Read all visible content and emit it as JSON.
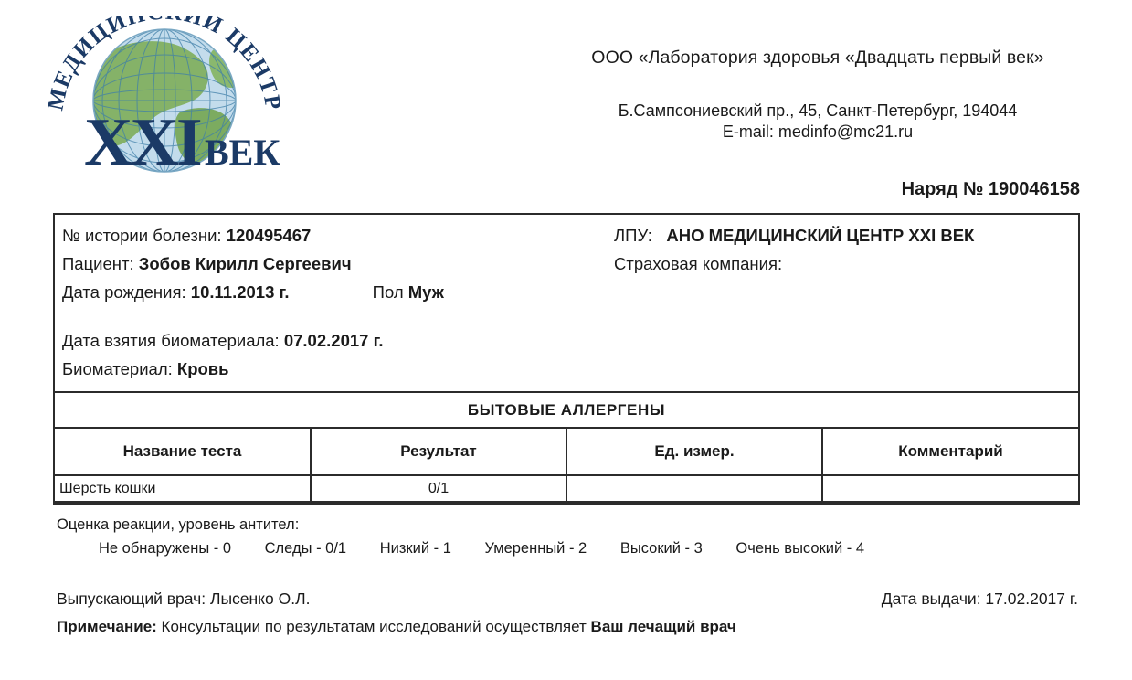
{
  "logo": {
    "arc_text": "МЕДИЦИНСКИЙ ЦЕНТР",
    "main_text": "XXI",
    "sub_text": "ВЕК",
    "arc_color": "#1b3a66",
    "main_color": "#1b3a66",
    "ocean_color": "#bcd9ea",
    "land_color": "#7fae63",
    "grid_color": "#3f7fa8"
  },
  "header": {
    "org_name": "ООО «Лаборатория здоровья «Двадцать первый век»",
    "address": "Б.Сампсониевский пр., 45, Санкт-Петербург, 194044",
    "email": "E-mail: medinfo@mc21.ru",
    "order_label": "Наряд № 190046158"
  },
  "patient": {
    "case_label": "№ истории болезни:",
    "case_value": "120495467",
    "patient_label": "Пациент:",
    "patient_value": "Зобов Кирилл Сергеевич",
    "birth_label": "Дата рождения:",
    "birth_value": "10.11.2013 г.",
    "gender_label": "Пол",
    "gender_value": "Муж",
    "collection_label": "Дата взятия биоматериала:",
    "collection_value": "07.02.2017 г.",
    "biomaterial_label": "Биоматериал:",
    "biomaterial_value": "Кровь",
    "facility_label": "ЛПУ:",
    "facility_value": "АНО МЕДИЦИНСКИЙ ЦЕНТР XXI ВЕК",
    "insurance_label": "Страховая компания:",
    "insurance_value": ""
  },
  "table": {
    "section_title": "БЫТОВЫЕ АЛЛЕРГЕНЫ",
    "columns": {
      "name": "Название теста",
      "result": "Результат",
      "unit": "Ед. измер.",
      "comment": "Комментарий"
    },
    "rows": [
      {
        "name": "Шерсть кошки",
        "result": "0/1",
        "unit": "",
        "comment": ""
      }
    ]
  },
  "legend": {
    "title": "Оценка реакции, уровень антител:",
    "items": [
      "Не обнаружены - 0",
      "Следы - 0/1",
      "Низкий - 1",
      "Умеренный - 2",
      "Высокий  - 3",
      "Очень высокий - 4"
    ]
  },
  "footer": {
    "doctor_label": "Выпускающий врач: Лысенко О.Л.",
    "issue_date_label": "Дата выдачи: 17.02.2017 г.",
    "note_label": "Примечание:",
    "note_text": " Консультации по результатам исследований осуществляет ",
    "note_bold": "Ваш лечащий врач"
  }
}
